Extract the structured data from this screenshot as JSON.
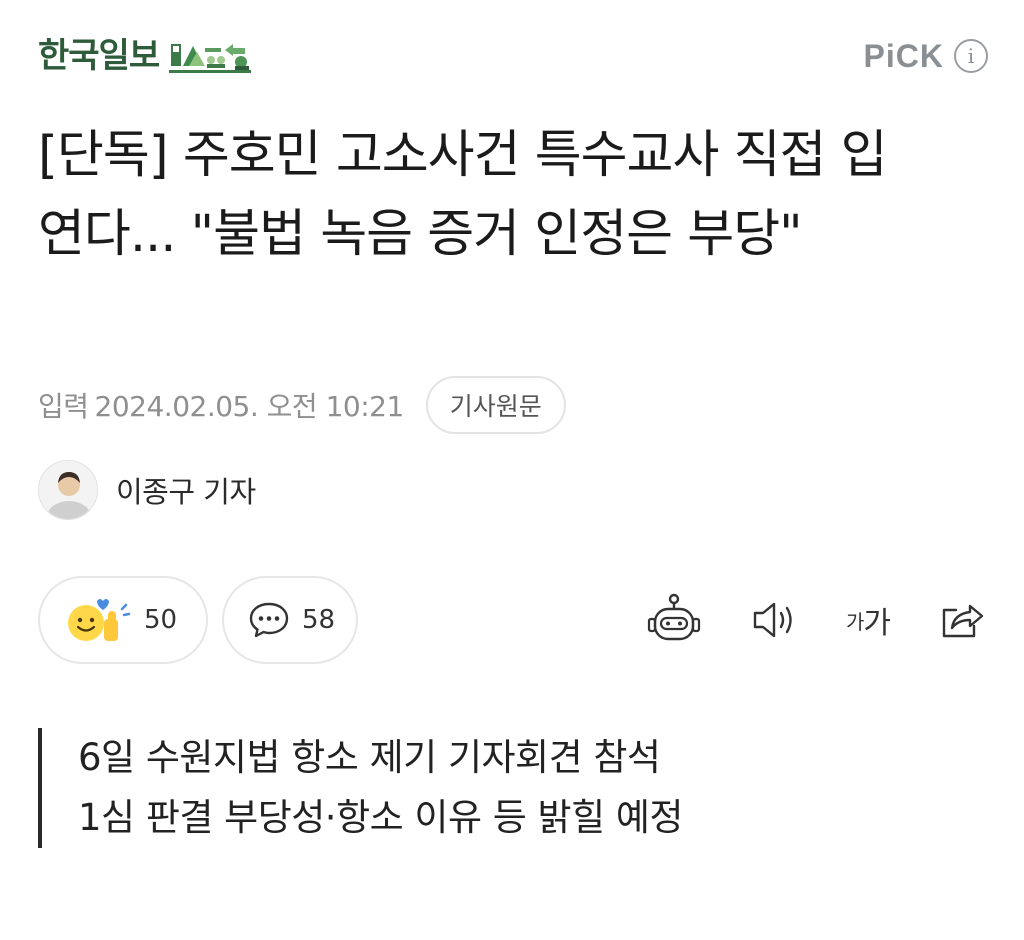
{
  "header": {
    "press_name": "한국일보",
    "pick_label": "PiCK",
    "info_icon": "info-icon",
    "brand_color": "#2e5b3a"
  },
  "article": {
    "headline": "[단독] 주호민 고소사건 특수교사 직접 입 연다... \"불법 녹음 증거 인정은 부당\"",
    "input_label": "입력",
    "datetime": "2024.02.05. 오전 10:21",
    "original_button": "기사원문",
    "reporter": "이종구 기자"
  },
  "actions": {
    "reaction_count": "50",
    "comment_count": "58",
    "icons": [
      "emoji-reaction-icon",
      "comment-bubble-icon",
      "robot-summary-icon",
      "speaker-icon",
      "font-size-icon",
      "share-icon"
    ],
    "font_size_label_small": "가",
    "font_size_label_large": "가"
  },
  "summary": {
    "lines": [
      "6일 수원지법 항소 제기 기자회견 참석",
      "1심 판결 부당성·항소 이유 등 밝힐 예정"
    ]
  }
}
